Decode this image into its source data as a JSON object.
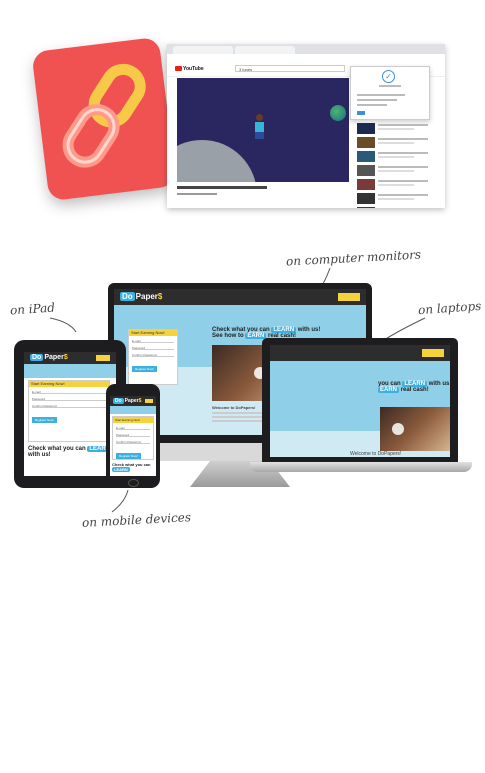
{
  "labels": {
    "monitors": "on computer monitors",
    "ipad": "on iPad",
    "laptops": "on laptops",
    "mobile": "on mobile devices"
  },
  "site": {
    "logo_do": "Do",
    "logo_rest": "Paper",
    "logo_dollar": "$",
    "headline_1": "Check what you can",
    "headline_badge": "LEARN",
    "headline_2": "with us!",
    "headline_3": "See how to",
    "headline_badge2": "EARN",
    "headline_4": "real cash!",
    "form_title": "Start Earning Now!",
    "field_email": "E-mail",
    "field_password": "Password",
    "field_confirm": "Confirm Password",
    "register_btn": "Register Now!",
    "welcome": "Welcome to DoPapers!"
  },
  "youtube": {
    "logo": "YouTube",
    "search_value": "3 tunes"
  },
  "colors": {
    "icon_bg": "#f05252",
    "chain_gold": "#f7c948",
    "brand_blue": "#3db0e0",
    "brand_yellow": "#f6d23b"
  }
}
